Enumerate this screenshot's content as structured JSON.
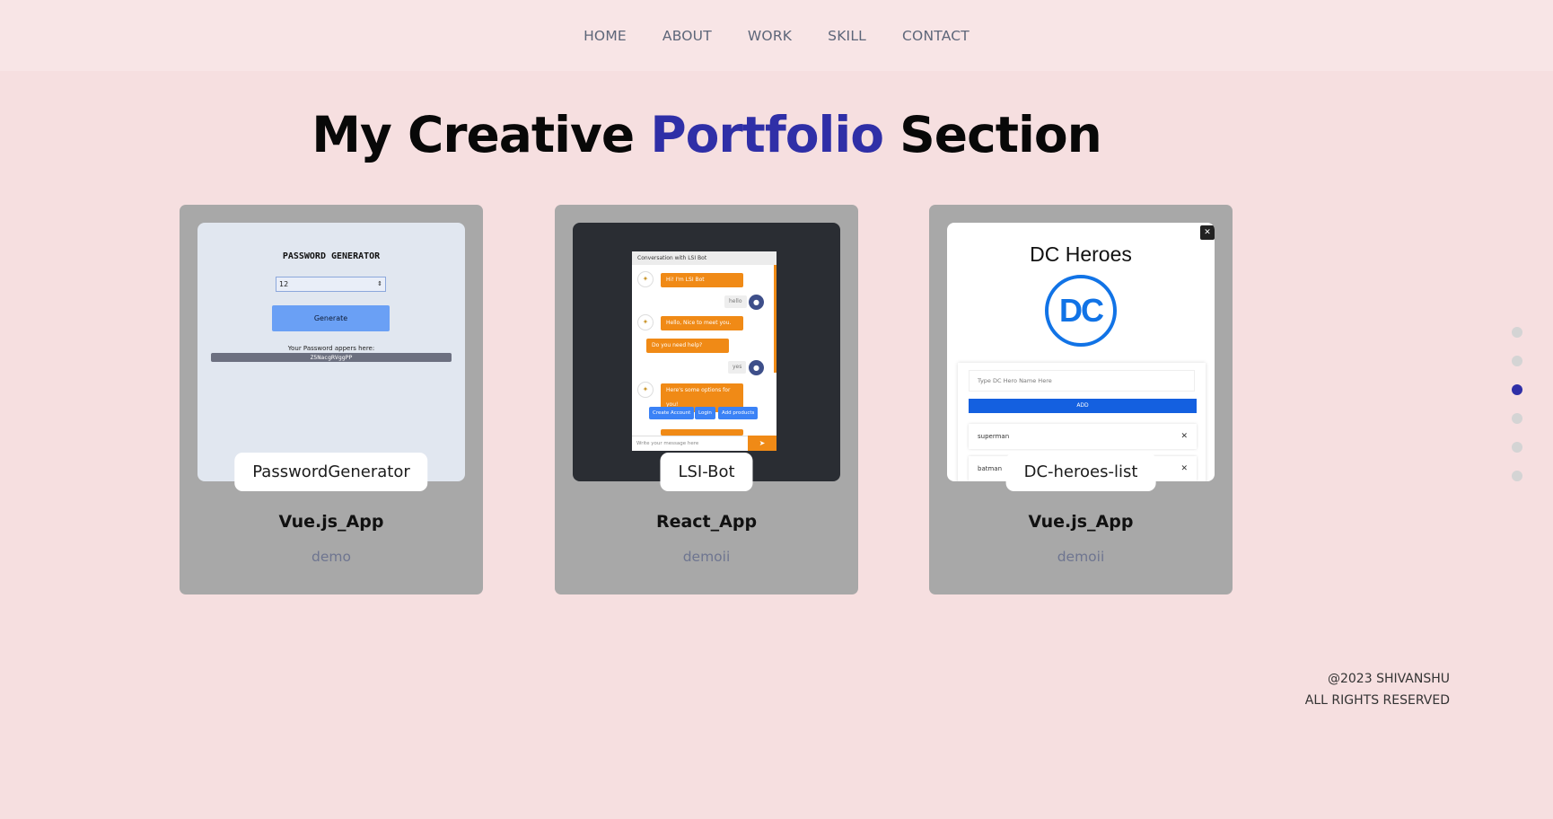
{
  "nav": {
    "items": [
      "HOME",
      "ABOUT",
      "WORK",
      "SKILL",
      "CONTACT"
    ]
  },
  "heading": {
    "part1": "My Creative ",
    "accent": "Portfolio",
    "part2": " Section"
  },
  "cards": [
    {
      "badge": "PasswordGenerator",
      "title": "Vue.js_App",
      "link": "demo",
      "preview": {
        "title": "PASSWORD GENERATOR",
        "input_value": "12",
        "button": "Generate",
        "label": "Your Password appers here:",
        "password": "Z5NacgRVggPP"
      }
    },
    {
      "badge": "LSI-Bot",
      "title": "React_App",
      "link": "demoii",
      "preview": {
        "header": "Conversation with LSI Bot",
        "bot_msg1": "Hi! I'm LSI Bot",
        "user_msg1": "hello",
        "bot_msg2": "Hello, Nice to meet you.",
        "bot_msg3": "Do you need help?",
        "user_msg2": "yes",
        "bot_msg4": "Here's some options for you!",
        "options": [
          "Create Account",
          "Login",
          "Add products"
        ],
        "placeholder": "Write your message here"
      }
    },
    {
      "badge": "DC-heroes-list",
      "title": "Vue.js_App",
      "link": "demoii",
      "preview": {
        "title": "DC Heroes",
        "logo": "DC",
        "placeholder": "Type DC Hero Name Here",
        "button": "ADD",
        "items": [
          "superman",
          "batman"
        ]
      }
    }
  ],
  "pager": {
    "count": 6,
    "active_index": 2,
    "active_color": "#2f2fa7"
  },
  "footer": {
    "line1": "@2023 SHIVANSHU",
    "line2": "ALL RIGHTS RESERVED"
  },
  "colors": {
    "background": "#f6dfe0",
    "nav_background": "#f8e5e6",
    "accent": "#2f2fa7",
    "card": "#a8a8a8"
  }
}
